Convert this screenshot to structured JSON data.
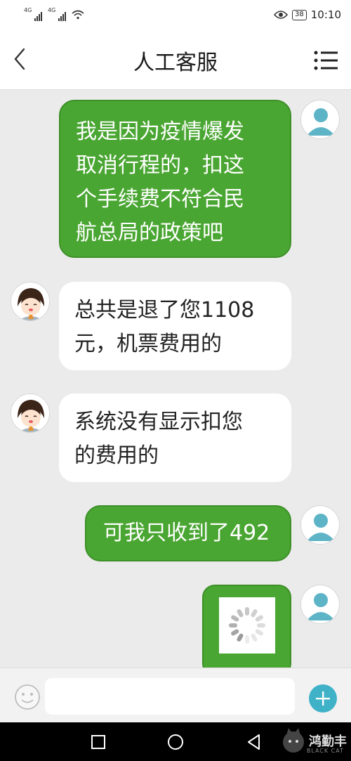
{
  "status_bar": {
    "signal1_tag": "4G",
    "signal2_tag": "4G",
    "battery": "38",
    "time": "10:10"
  },
  "header": {
    "title": "人工客服"
  },
  "messages": [
    {
      "sender": "user",
      "lines": [
        "我是因为疫情爆发",
        "取消行程的，扣这",
        "个手续费不符合民",
        "航总局的政策吧"
      ]
    },
    {
      "sender": "agent",
      "lines": [
        "总共是退了您1108",
        "元，机票费用的"
      ]
    },
    {
      "sender": "agent",
      "lines": [
        "系统没有显示扣您",
        "的费用的"
      ]
    },
    {
      "sender": "user",
      "lines": [
        "可我只收到了492"
      ]
    },
    {
      "sender": "user",
      "type": "image-loading"
    }
  ],
  "input": {
    "placeholder": ""
  },
  "watermark": {
    "text": "鸿勤丰",
    "sub": "BLACK CAT"
  },
  "colors": {
    "outgoing_bubble": "#4aa632",
    "incoming_bubble": "#ffffff",
    "chat_background": "#ebebeb",
    "add_button": "#3fb2c8"
  }
}
